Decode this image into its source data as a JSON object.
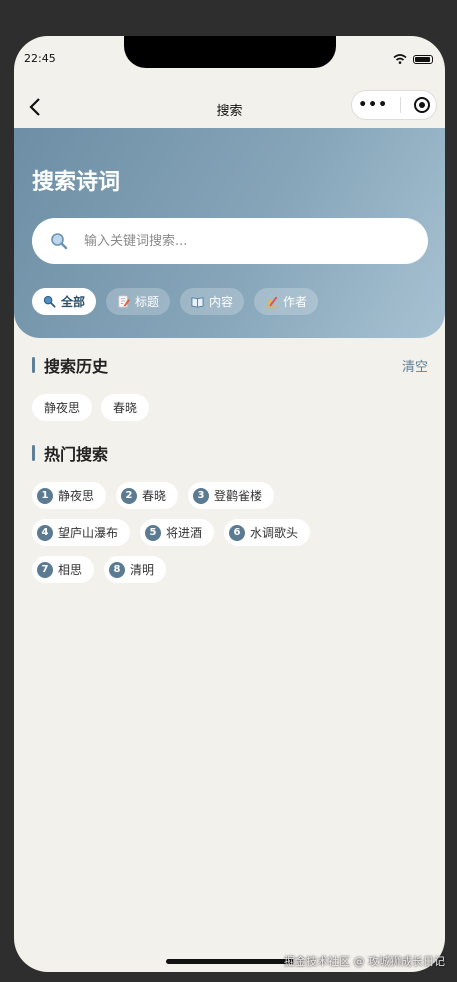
{
  "status_bar": {
    "time": "22:45"
  },
  "navbar": {
    "title": "搜索"
  },
  "hero": {
    "title": "搜索诗词",
    "search_placeholder": "输入关键词搜索...",
    "tabs": [
      {
        "label": "全部",
        "icon": "search-icon",
        "active": true
      },
      {
        "label": "标题",
        "icon": "memo-icon",
        "active": false
      },
      {
        "label": "内容",
        "icon": "book-icon",
        "active": false
      },
      {
        "label": "作者",
        "icon": "writing-hand-icon",
        "active": false
      }
    ]
  },
  "history": {
    "title": "搜索历史",
    "clear_label": "清空",
    "items": [
      "静夜思",
      "春晓"
    ]
  },
  "hot": {
    "title": "热门搜索",
    "items": [
      {
        "rank": "1",
        "label": "静夜思"
      },
      {
        "rank": "2",
        "label": "春晓"
      },
      {
        "rank": "3",
        "label": "登鹳雀楼"
      },
      {
        "rank": "4",
        "label": "望庐山瀑布"
      },
      {
        "rank": "5",
        "label": "将进酒"
      },
      {
        "rank": "6",
        "label": "水调歌头"
      },
      {
        "rank": "7",
        "label": "相思"
      },
      {
        "rank": "8",
        "label": "清明"
      }
    ]
  },
  "watermark": "掘金技术社区 @ 攻城狮成长日记",
  "colors": {
    "accent": "#5b7b93",
    "background": "#f3f1ec",
    "hero_start": "#6d8ea5",
    "hero_end": "#a7c2d2"
  }
}
